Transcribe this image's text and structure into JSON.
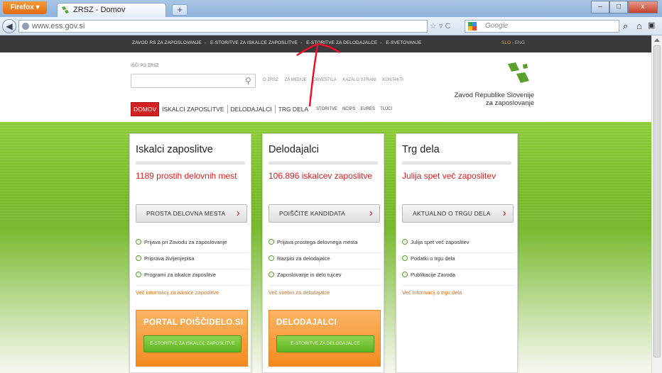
{
  "browser": {
    "menu_label": "Firefox",
    "tab_title": "ZRSZ - Domov",
    "new_tab": "+",
    "url": "www.ess.gov.si",
    "search_placeholder": "Google",
    "window_buttons": [
      "–",
      "□",
      "x"
    ]
  },
  "top_strip": {
    "links": [
      "ZAVOD RS ZA ZAPOSLOVANJE",
      "E-STORITVE ZA ISKALCE ZAPOSLITVE",
      "E-STORITVE ZA DELODAJALCE",
      "E-SVETOVANJE"
    ],
    "lang_active": "SLO",
    "lang_other": "ENG"
  },
  "header": {
    "search_label": "IŠČI PO ZRSZ",
    "util_links": [
      "O ZRSZ",
      "ZA MEDIJE",
      "OBVESTILA",
      "KAZALO STRANI",
      "KONTAKTI"
    ],
    "logo_line1": "Zavod Republike Slovenije",
    "logo_line2": "za zaposlovanje"
  },
  "mainnav": {
    "home": "DOMOV",
    "items": [
      "ISKALCI ZAPOSLITVE",
      "DELODAJALCI",
      "TRG DELA"
    ],
    "small": [
      "STORITVE",
      "NCIPS",
      "EURES",
      "TUJCI"
    ]
  },
  "cards": [
    {
      "title": "Iskalci zaposlitve",
      "headline": "1189 prostih delovnih mest",
      "button": "PROSTA DELOVNA MESTA",
      "links": [
        "Prijava pri Zavodu za zaposlovanje",
        "Priprava življenjepisa",
        "Programi za iskalce zaposlitve"
      ],
      "more": "Več informacij za iskalce zaposlitve",
      "promo_title": "PORTAL POIŠČIDELO.SI",
      "promo_button": "E-STORITVE ZA ISKALCE ZAPOSLITVE"
    },
    {
      "title": "Delodajalci",
      "headline": "106.896 iskalcev zaposlitve",
      "button": "POIŠČITE KANDIDATA",
      "links": [
        "Prijava prostega delovnega mesta",
        "Razpisi za delodajalce",
        "Zaposlovanje in delo tujcev"
      ],
      "more": "Več vsebin za delodajalce",
      "promo_title": "DELODAJALCI",
      "promo_button": "E-STORITVE ZA DELODAJALCE"
    },
    {
      "title": "Trg dela",
      "headline": "Julija spet več zaposlitev",
      "button": "AKTUALNO O TRGU DELA",
      "links": [
        "Julija spet več zaposlitev",
        "Podatki o trgu dela",
        "Publikacije Zavoda"
      ],
      "more": "Več informacij o trgu dela"
    }
  ],
  "colors": {
    "accent_red": "#d32020",
    "brand_green": "#5db322",
    "orange": "#f28a1e",
    "annotation_arrow": "#e8122a"
  }
}
